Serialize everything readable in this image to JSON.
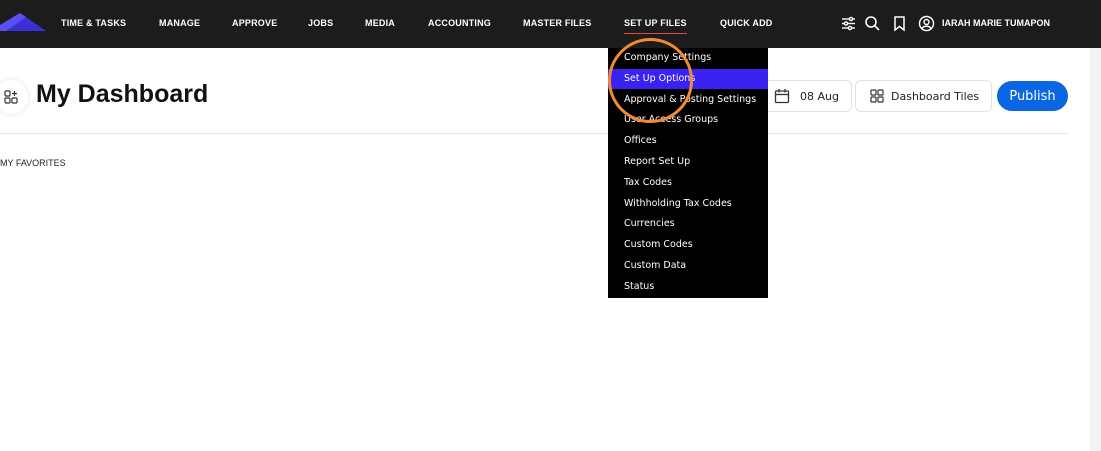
{
  "nav": {
    "items": [
      {
        "label": "TIME & TASKS"
      },
      {
        "label": "MANAGE"
      },
      {
        "label": "APPROVE"
      },
      {
        "label": "JOBS"
      },
      {
        "label": "MEDIA"
      },
      {
        "label": "ACCOUNTING"
      },
      {
        "label": "MASTER FILES"
      },
      {
        "label": "SET UP FILES",
        "active": true
      },
      {
        "label": "QUICK ADD"
      }
    ],
    "icons": [
      "filter-sliders-icon",
      "search-icon",
      "bookmark-icon",
      "user-circle-icon"
    ],
    "user_name": "IARAH MARIE TUMAPON",
    "accent_color": "#e8473c"
  },
  "page": {
    "title": "My Dashboard",
    "favorites_label": "MY FAVORITES",
    "date_label": "08 Aug",
    "tiles_label": "Dashboard Tiles",
    "publish_label": "Publish",
    "publish_color": "#0b66e4"
  },
  "dropdown": {
    "items": [
      {
        "label": "Company Settings"
      },
      {
        "label": "Set Up Options",
        "active": true
      },
      {
        "label": "Approval & Posting Settings"
      },
      {
        "label": "User Access Groups"
      },
      {
        "label": "Offices"
      },
      {
        "label": "Report Set Up"
      },
      {
        "label": "Tax Codes"
      },
      {
        "label": "Withholding Tax Codes"
      },
      {
        "label": "Currencies"
      },
      {
        "label": "Custom Codes"
      },
      {
        "label": "Custom Data"
      },
      {
        "label": "Status"
      }
    ],
    "active_color": "#3a22f2",
    "highlight_color": "#f28a33"
  }
}
